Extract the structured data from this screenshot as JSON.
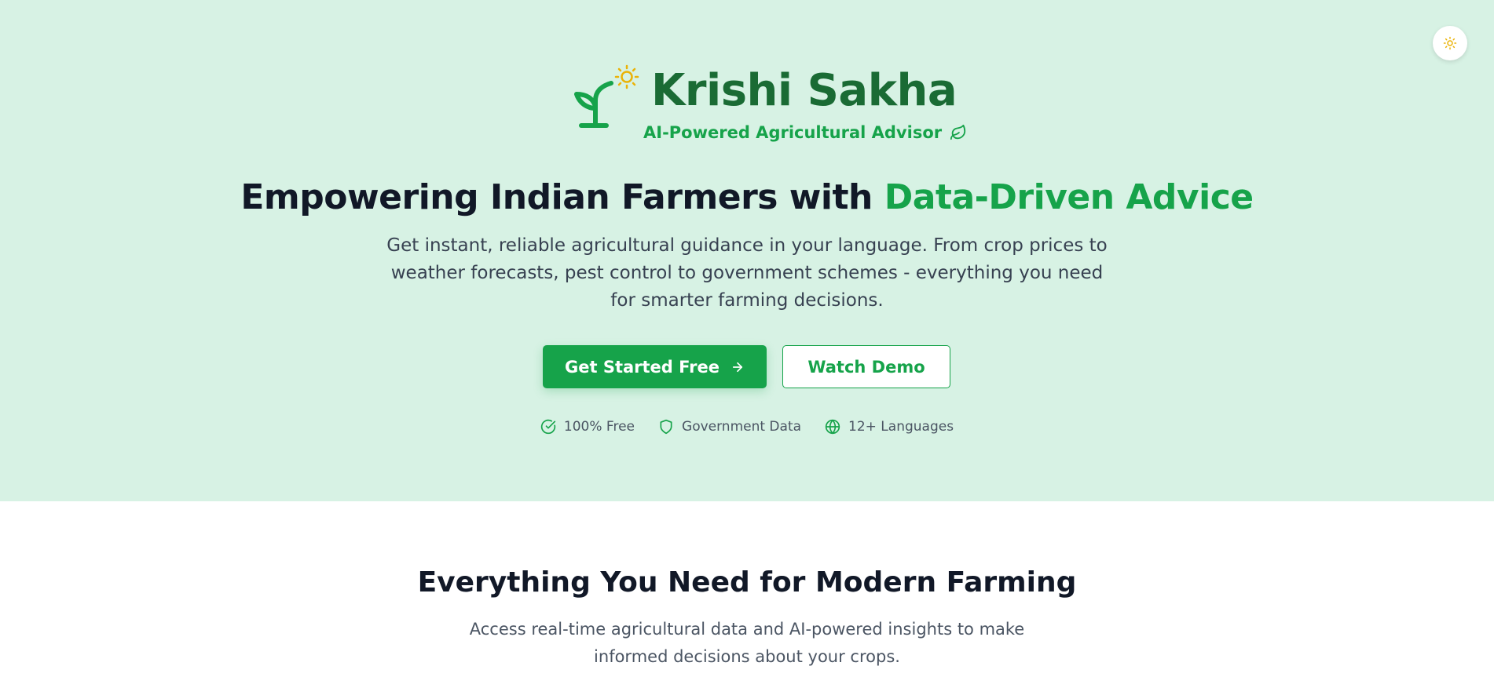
{
  "theme_toggle": {
    "icon": "sun-icon",
    "color": "#eab308"
  },
  "brand": {
    "name": "Krishi Sakha",
    "tagline": "AI-Powered Agricultural Advisor",
    "logo_icon": "sprout-icon",
    "accent_icon": "leaf-icon",
    "colors": {
      "title": "#1a6b34",
      "accent": "#16a34a",
      "sun": "#eab308"
    }
  },
  "hero": {
    "headline_prefix": "Empowering Indian Farmers with",
    "headline_accent": "Data-Driven Advice",
    "description": "Get instant, reliable agricultural guidance in your language. From crop prices to weather forecasts, pest control to government schemes - everything you need for smarter farming decisions.",
    "primary_cta": "Get Started Free",
    "secondary_cta": "Watch Demo",
    "background": "#d7f2e4",
    "badges": [
      {
        "icon": "check-circle-icon",
        "label": "100% Free"
      },
      {
        "icon": "shield-icon",
        "label": "Government Data"
      },
      {
        "icon": "globe-icon",
        "label": "12+ Languages"
      }
    ]
  },
  "features": {
    "title": "Everything You Need for Modern Farming",
    "description": "Access real-time agricultural data and AI-powered insights to make informed decisions about your crops."
  }
}
